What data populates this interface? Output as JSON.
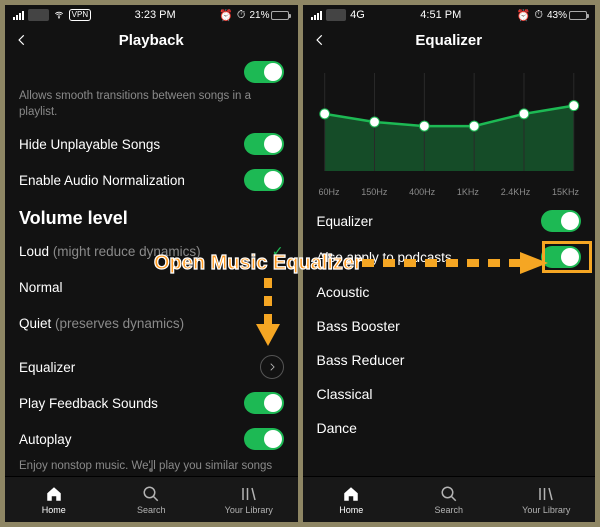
{
  "annotation": {
    "label": "Open Music Equalizer"
  },
  "left": {
    "status": {
      "carrier_hidden": "----",
      "vpn": "VPN",
      "time": "3:23 PM",
      "alarm": true,
      "battery_pct": "21%",
      "battery_fill": 21,
      "charging": true
    },
    "header": {
      "title": "Playback"
    },
    "rows": {
      "automix_hint": "Allows smooth transitions between songs in a playlist.",
      "hide_unplayable": "Hide Unplayable Songs",
      "audio_norm": "Enable Audio Normalization",
      "volume_section": "Volume level",
      "loud": "Loud",
      "loud_note": "(might reduce dynamics)",
      "normal": "Normal",
      "quiet": "Quiet",
      "quiet_note": "(preserves dynamics)",
      "equalizer": "Equalizer",
      "feedback": "Play Feedback Sounds",
      "autoplay": "Autoplay",
      "autoplay_hint": "Enjoy nonstop music. We'll play you similar songs when your music ends."
    },
    "nav": {
      "home": "Home",
      "search": "Search",
      "library": "Your Library"
    }
  },
  "right": {
    "status": {
      "carrier_hidden": "----",
      "net": "4G",
      "time": "4:51 PM",
      "alarm": true,
      "battery_pct": "43%",
      "battery_fill": 43
    },
    "header": {
      "title": "Equalizer"
    },
    "eq": {
      "toggle_label": "Equalizer",
      "podcasts": "Also apply to podcasts",
      "presets": [
        "Acoustic",
        "Bass Booster",
        "Bass Reducer",
        "Classical",
        "Dance"
      ]
    },
    "nav": {
      "home": "Home",
      "search": "Search",
      "library": "Your Library"
    }
  },
  "chart_data": {
    "type": "line",
    "title": "Equalizer",
    "xlabel": "",
    "ylabel": "",
    "categories": [
      "60Hz",
      "150Hz",
      "400Hz",
      "1KHz",
      "2.4KHz",
      "15KHz"
    ],
    "values": [
      2,
      0,
      -1,
      -1,
      2,
      4
    ],
    "ylim": [
      -12,
      12
    ]
  }
}
